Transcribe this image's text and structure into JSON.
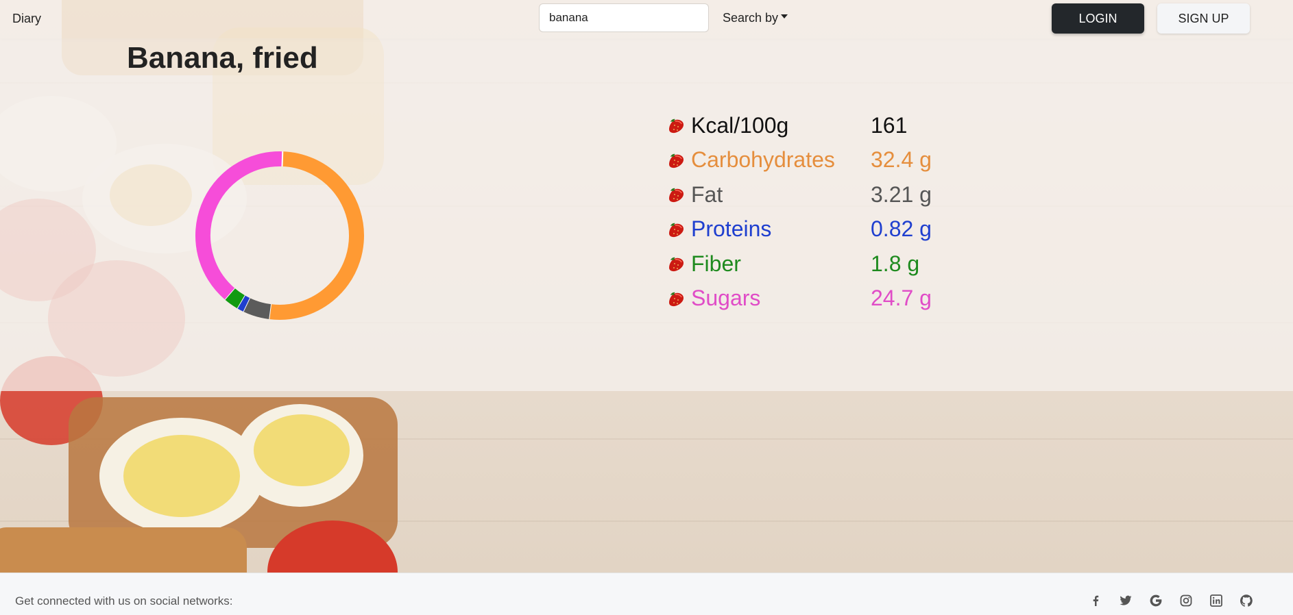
{
  "navbar": {
    "brand": "Diary",
    "search_value": "banana",
    "search_by_label": "Search by",
    "login_label": "LOGIN",
    "signup_label": "SIGN UP"
  },
  "food": {
    "title": "Banana, fried",
    "nutrients": [
      {
        "label": "Kcal/100g",
        "value": "161",
        "color": "#111111"
      },
      {
        "label": "Carbohydrates",
        "value": "32.4 g",
        "color": "#e58e3d"
      },
      {
        "label": "Fat",
        "value": "3.21 g",
        "color": "#555555"
      },
      {
        "label": "Proteins",
        "value": "0.82 g",
        "color": "#1f3fcf"
      },
      {
        "label": "Fiber",
        "value": "1.8 g",
        "color": "#1e8a1e"
      },
      {
        "label": "Sugars",
        "value": "24.7 g",
        "color": "#e04cc7"
      }
    ]
  },
  "chart_data": {
    "type": "pie",
    "categories": [
      "Carbohydrates",
      "Fat",
      "Proteins",
      "Fiber",
      "Sugars"
    ],
    "values": [
      32.4,
      3.21,
      0.82,
      1.8,
      24.7
    ],
    "colors": [
      "#ff9a33",
      "#5b5b5b",
      "#1f3fcf",
      "#119a11",
      "#f64dd9"
    ],
    "style": "donut"
  },
  "footer": {
    "text": "Get connected with us on social networks:",
    "socials": [
      "facebook-icon",
      "twitter-icon",
      "google-icon",
      "instagram-icon",
      "linkedin-icon",
      "github-icon"
    ]
  }
}
